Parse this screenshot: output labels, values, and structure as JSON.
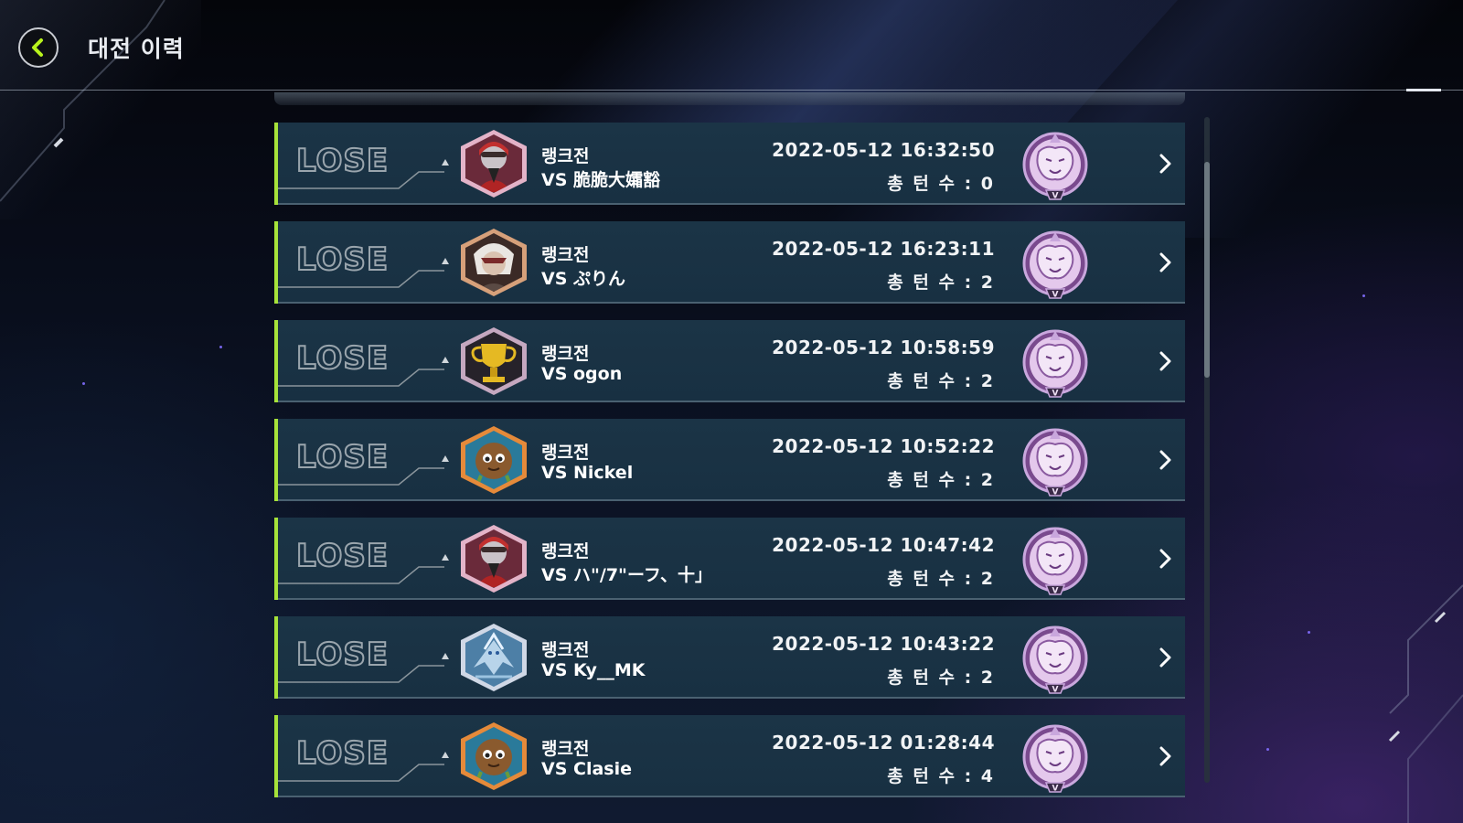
{
  "header": {
    "title": "대전 이력",
    "back_icon": "chevron-left-icon",
    "accent_color": "#b8f31c"
  },
  "history": [
    {
      "result": "LOSE",
      "mode": "랭크전",
      "opponent": "VS 脆脆大孀豁",
      "datetime": "2022-05-12 16:32:50",
      "turns": "총 턴 수 : 0",
      "avatar": "red-helmet-avatar",
      "rank_icon": "rank-emblem-beast"
    },
    {
      "result": "LOSE",
      "mode": "랭크전",
      "opponent": "VS ぷりん",
      "datetime": "2022-05-12 16:23:11",
      "turns": "총 턴 수 : 2",
      "avatar": "white-hair-avatar",
      "rank_icon": "rank-emblem-beast"
    },
    {
      "result": "LOSE",
      "mode": "랭크전",
      "opponent": "VS ogon",
      "datetime": "2022-05-12 10:58:59",
      "turns": "총 턴 수 : 2",
      "avatar": "gold-trophy-avatar",
      "rank_icon": "rank-emblem-beast"
    },
    {
      "result": "LOSE",
      "mode": "랭크전",
      "opponent": "VS Nickel",
      "datetime": "2022-05-12 10:52:22",
      "turns": "총 턴 수 : 2",
      "avatar": "kuriboh-avatar",
      "rank_icon": "rank-emblem-beast"
    },
    {
      "result": "LOSE",
      "mode": "랭크전",
      "opponent": "VS ハ\"/7\"ーフ、十」",
      "datetime": "2022-05-12 10:47:42",
      "turns": "총 턴 수 : 2",
      "avatar": "red-helmet-avatar",
      "rank_icon": "rank-emblem-beast"
    },
    {
      "result": "LOSE",
      "mode": "랭크전",
      "opponent": "VS Ky__MK",
      "datetime": "2022-05-12 10:43:22",
      "turns": "총 턴 수 : 2",
      "avatar": "blue-dragon-avatar",
      "rank_icon": "rank-emblem-beast"
    },
    {
      "result": "LOSE",
      "mode": "랭크전",
      "opponent": "VS Clasie",
      "datetime": "2022-05-12 01:28:44",
      "turns": "총 턴 수 : 4",
      "avatar": "kuriboh-avatar",
      "rank_icon": "rank-emblem-beast"
    }
  ],
  "scroll": {
    "position": 0.1
  }
}
